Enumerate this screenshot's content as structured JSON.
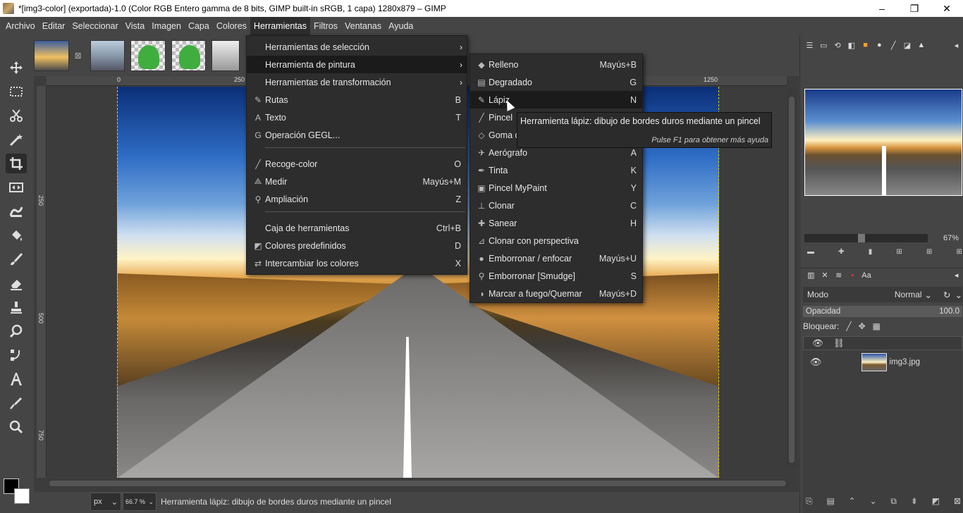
{
  "window": {
    "title": "*[img3-color] (exportada)-1.0 (Color RGB Entero gamma de 8 bits, GIMP built-in sRGB, 1 capa) 1280x879 – GIMP",
    "minimize": "–",
    "maximize": "❐",
    "close": "✕"
  },
  "menubar": [
    "Archivo",
    "Editar",
    "Seleccionar",
    "Vista",
    "Imagen",
    "Capa",
    "Colores",
    "Herramientas",
    "Filtros",
    "Ventanas",
    "Ayuda"
  ],
  "rulers": {
    "top": [
      "0",
      "250",
      "1250"
    ],
    "left": [
      "250",
      "500",
      "750"
    ]
  },
  "tools_menu": {
    "items": [
      {
        "label": "Herramientas de selección",
        "shortcut": "",
        "submenu": true
      },
      {
        "label": "Herramienta de pintura",
        "shortcut": "",
        "submenu": true,
        "highlighted": true
      },
      {
        "label": "Herramientas de transformación",
        "shortcut": "",
        "submenu": true
      },
      {
        "label": "Rutas",
        "shortcut": "B"
      },
      {
        "label": "Texto",
        "shortcut": "T"
      },
      {
        "label": "Operación GEGL...",
        "shortcut": ""
      },
      {
        "label": "Recoge-color",
        "shortcut": "O"
      },
      {
        "label": "Medir",
        "shortcut": "Mayús+M"
      },
      {
        "label": "Ampliación",
        "shortcut": "Z"
      },
      {
        "label": "Caja de herramientas",
        "shortcut": "Ctrl+B"
      },
      {
        "label": "Colores predefinidos",
        "shortcut": "D"
      },
      {
        "label": "Intercambiar los colores",
        "shortcut": "X"
      }
    ]
  },
  "paint_menu": {
    "items": [
      {
        "label": "Relleno",
        "shortcut": "Mayús+B"
      },
      {
        "label": "Degradado",
        "shortcut": "G"
      },
      {
        "label": "Lápiz",
        "shortcut": "N",
        "highlighted": true
      },
      {
        "label": "Pincel",
        "shortcut": ""
      },
      {
        "label": "Goma d",
        "shortcut": ""
      },
      {
        "label": "Aerógrafo",
        "shortcut": "A"
      },
      {
        "label": "Tinta",
        "shortcut": "K"
      },
      {
        "label": "Pincel MyPaint",
        "shortcut": "Y"
      },
      {
        "label": "Clonar",
        "shortcut": "C"
      },
      {
        "label": "Sanear",
        "shortcut": "H"
      },
      {
        "label": "Clonar con perspectiva",
        "shortcut": ""
      },
      {
        "label": "Emborronar / enfocar",
        "shortcut": "Mayús+U"
      },
      {
        "label": "Emborronar [Smudge]",
        "shortcut": "S"
      },
      {
        "label": "Marcar a fuego/Quemar",
        "shortcut": "Mayús+D"
      }
    ]
  },
  "tooltip": {
    "text": "Herramienta lápiz: dibujo de bordes duros mediante un pincel",
    "help": "Pulse F1 para obtener más ayuda"
  },
  "statusbar": {
    "unit": "px",
    "zoom": "66.7 %",
    "message": "Herramienta lápiz: dibujo de bordes duros mediante un pincel"
  },
  "navigator": {
    "zoom": "67%",
    "zoom_level": 0.67
  },
  "layers": {
    "mode_label": "Modo",
    "mode_value": "Normal",
    "opacity_label": "Opacidad",
    "opacity_value": "100.0",
    "lock_label": "Bloquear:",
    "layer_name": "img3.jpg"
  },
  "colors": {
    "foreground": "#000000",
    "background": "#ffffff",
    "guide": "#e8d000"
  }
}
